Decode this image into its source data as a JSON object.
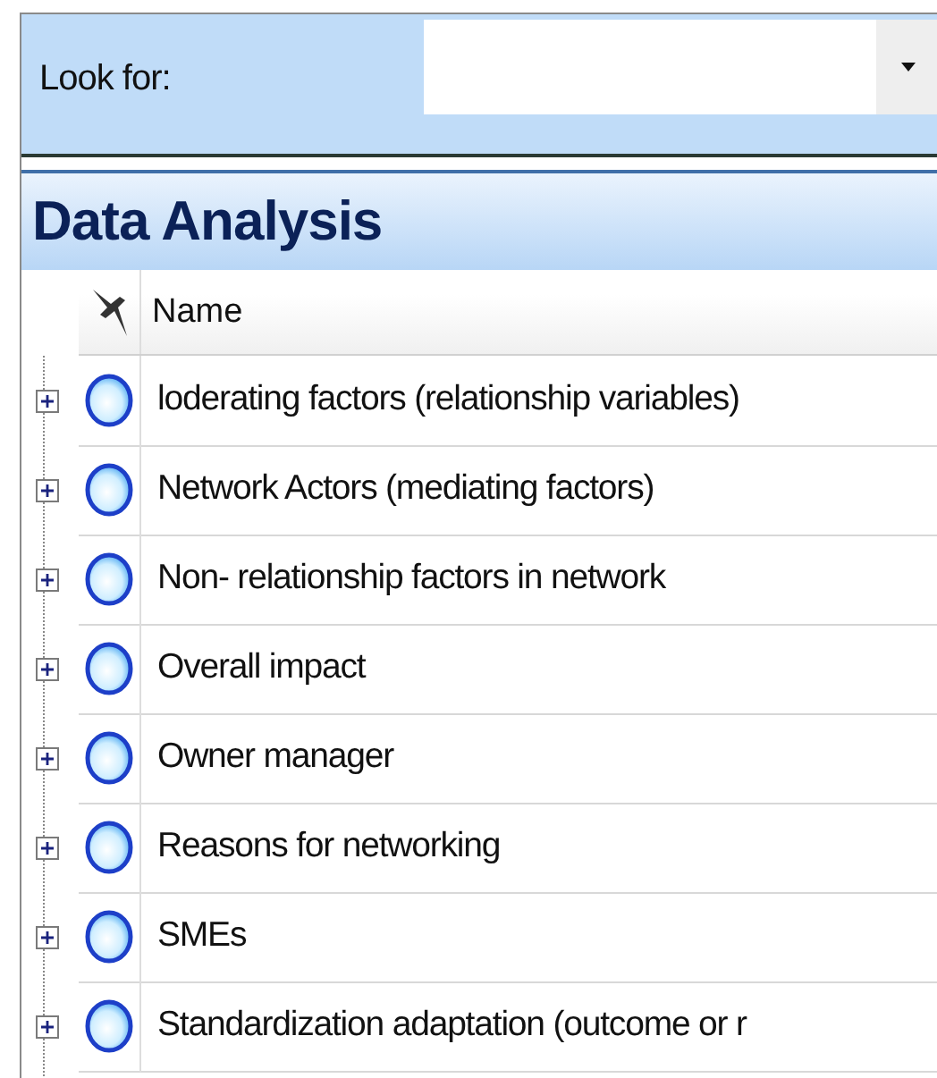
{
  "search": {
    "label": "Look for:"
  },
  "panel": {
    "title": "Data Analysis"
  },
  "table": {
    "columns": [
      "Name"
    ],
    "rows": [
      {
        "name": "loderating factors (relationship variables)",
        "expanded": false
      },
      {
        "name": "Network Actors (mediating factors)",
        "expanded": false
      },
      {
        "name": "Non- relationship factors in network",
        "expanded": false
      },
      {
        "name": "Overall impact",
        "expanded": false
      },
      {
        "name": "Owner manager",
        "expanded": false
      },
      {
        "name": "Reasons for networking",
        "expanded": false
      },
      {
        "name": "SMEs",
        "expanded": false
      },
      {
        "name": "Standardization adaptation (outcome or r",
        "expanded": false
      }
    ]
  }
}
